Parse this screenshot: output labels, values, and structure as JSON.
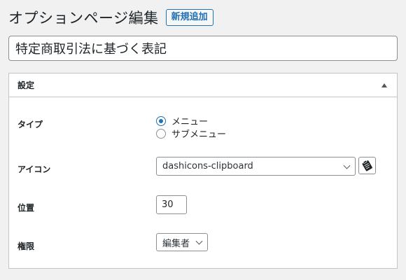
{
  "header": {
    "page_title": "オプションページ編集",
    "add_new_label": "新規追加"
  },
  "title_field": {
    "value": "特定商取引法に基づく表記"
  },
  "settings_box": {
    "title": "設定",
    "fields": {
      "type": {
        "label": "タイプ",
        "options": [
          {
            "label": "メニュー",
            "checked": true
          },
          {
            "label": "サブメニュー",
            "checked": false
          }
        ]
      },
      "icon": {
        "label": "アイコン",
        "selected": "dashicons-clipboard",
        "preview_icon": "clipboard-icon"
      },
      "position": {
        "label": "位置",
        "value": "30"
      },
      "capability": {
        "label": "権限",
        "selected": "編集者"
      }
    }
  }
}
